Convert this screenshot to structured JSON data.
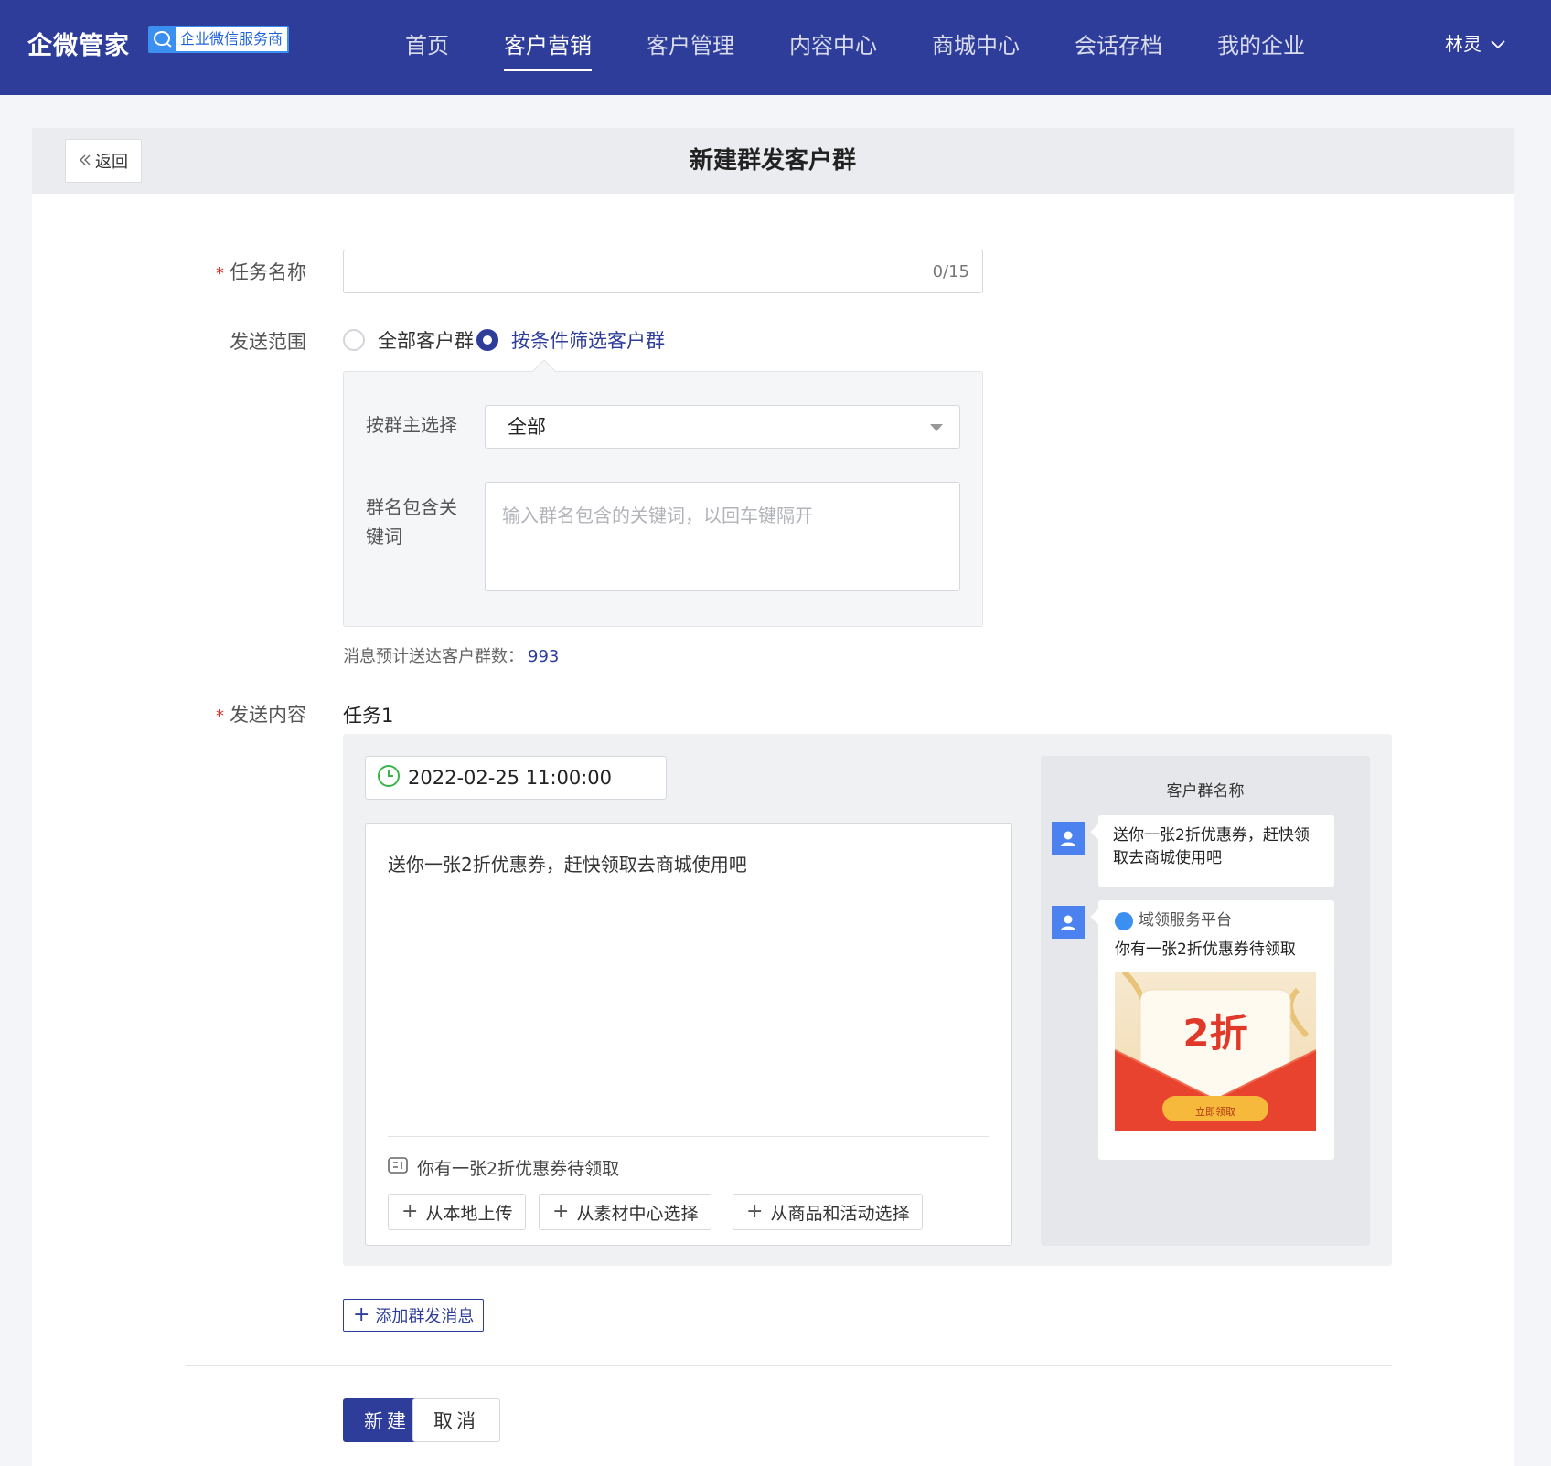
{
  "nav": {
    "brand": "企微管家",
    "badge": "企业微信服务商",
    "items": [
      "首页",
      "客户营销",
      "客户管理",
      "内容中心",
      "商城中心",
      "会话存档",
      "我的企业"
    ],
    "active_index": 1,
    "user": "林灵"
  },
  "header": {
    "back_label": "返回",
    "title": "新建群发客户群"
  },
  "form": {
    "task_name": {
      "label": "任务名称",
      "value": "",
      "counter": "0/15"
    },
    "scope": {
      "label": "发送范围",
      "options": [
        "全部客户群",
        "按条件筛选客户群"
      ],
      "selected_index": 1
    },
    "filter": {
      "owner_label": "按群主选择",
      "owner_value": "全部",
      "keyword_label_1": "群名包含关",
      "keyword_label_2": "键词",
      "keyword_placeholder": "输入群名包含的关键词，以回车键隔开"
    },
    "estimate": {
      "label": "消息预计送达客户群数：",
      "count": "993"
    },
    "content": {
      "label": "发送内容",
      "task_title": "任务1",
      "datetime": "2022-02-25 11:00:00",
      "message": "送你一张2折优惠券，赶快领取去商城使用吧",
      "attachment": "你有一张2折优惠券待领取",
      "buttons": [
        "从本地上传",
        "从素材中心选择",
        "从商品和活动选择"
      ]
    }
  },
  "preview": {
    "title": "客户群名称",
    "bubble_text_1": "送你一张2折优惠券，赶快领",
    "bubble_text_2": "取去商城使用吧",
    "mini_source": "域领服务平台",
    "mini_title": "你有一张2折优惠券待领取",
    "coupon_value": "2折",
    "coupon_button": "立即领取"
  },
  "actions": {
    "add_message": "添加群发消息",
    "create": "新建",
    "cancel": "取消"
  },
  "colors": {
    "primary": "#2e3d9a",
    "required": "#e0302b",
    "avatar": "#4c82ef",
    "coupon_red": "#e8432e"
  }
}
